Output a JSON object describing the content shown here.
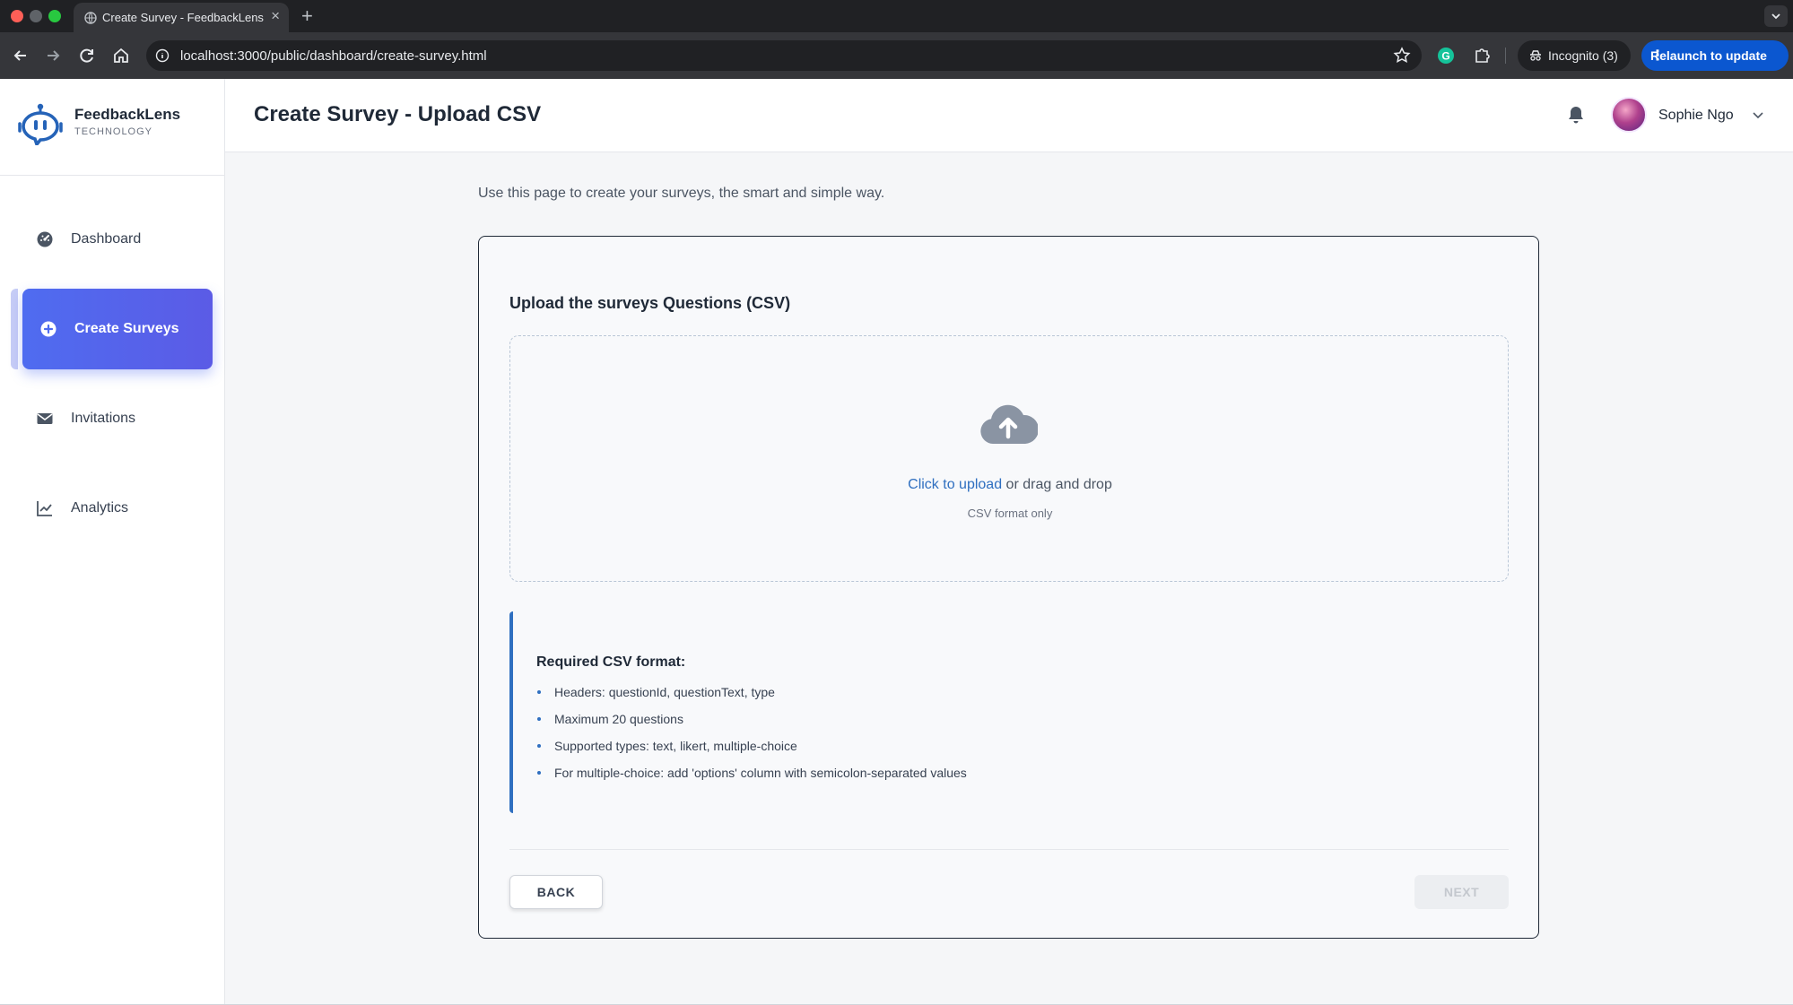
{
  "browser": {
    "tab_title": "Create Survey - FeedbackLens",
    "url": "localhost:3000/public/dashboard/create-survey.html",
    "incognito_label": "Incognito (3)",
    "relaunch_label": "Relaunch to update"
  },
  "brand": {
    "name": "FeedbackLens",
    "subtitle": "TECHNOLOGY"
  },
  "sidebar": {
    "items": [
      {
        "label": "Dashboard",
        "icon": "dashboard-icon",
        "active": false
      },
      {
        "label": "Create Surveys",
        "icon": "plus-circle-icon",
        "active": true
      },
      {
        "label": "Invitations",
        "icon": "envelope-icon",
        "active": false
      },
      {
        "label": "Analytics",
        "icon": "chart-line-icon",
        "active": false
      }
    ]
  },
  "header": {
    "title": "Create Survey - Upload CSV",
    "user_name": "Sophie Ngo"
  },
  "main": {
    "intro": "Use this page to create your surveys, the smart and simple way.",
    "upload": {
      "heading": "Upload the surveys Questions (CSV)",
      "link_text": "Click to upload",
      "rest_text": " or drag and drop",
      "hint": "CSV format only"
    },
    "format": {
      "title": "Required CSV format:",
      "items": [
        "Headers: questionId, questionText, type",
        "Maximum 20 questions",
        "Supported types: text, likert, multiple-choice",
        "For multiple-choice: add 'options' column with semicolon-separated values"
      ]
    },
    "buttons": {
      "back": "BACK",
      "next": "NEXT"
    }
  },
  "colors": {
    "accent": "#4f6cf0",
    "link": "#2f6fc0",
    "background": "#f5f6f8"
  }
}
